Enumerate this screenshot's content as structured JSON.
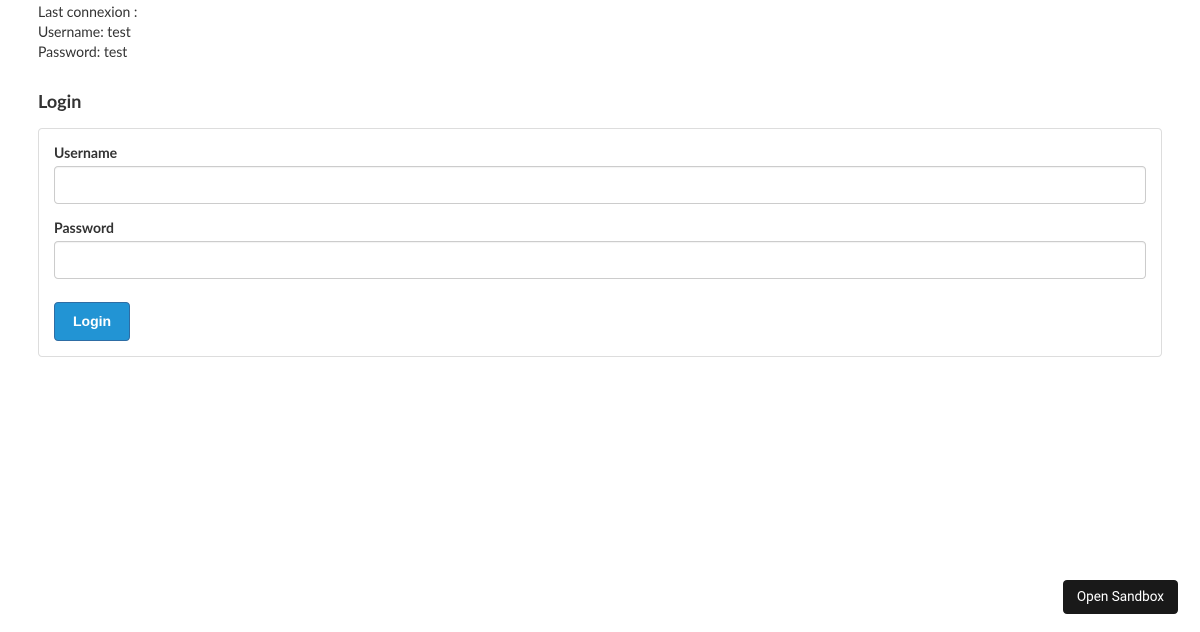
{
  "info": {
    "last_connexion_label": "Last connexion :",
    "username_label": "Username:",
    "username_value": "test",
    "password_label": "Password:",
    "password_value": "test"
  },
  "login": {
    "heading": "Login",
    "username_label": "Username",
    "username_value": "",
    "password_label": "Password",
    "password_value": "",
    "submit_label": "Login"
  },
  "sandbox": {
    "open_label": "Open Sandbox"
  }
}
